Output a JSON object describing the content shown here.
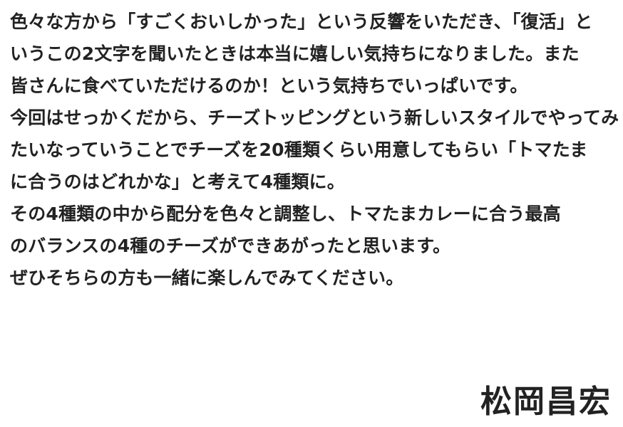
{
  "message": {
    "lines": [
      "色々な方から「すごくおいしかった」という反響をいただき、「復活」と",
      "いうこの2文字を聞いたときは本当に嬉しい気持ちになりました。また",
      "皆さんに食べていただけるのか！という気持ちでいっぱいです。",
      "今回はせっかくだから、チーズトッピングという新しいスタイルでやってみ",
      "たいなっていうことでチーズを20種類くらい用意してもらい「トマたま",
      "に合うのはどれかな」と考えて4種類に。",
      "その4種類の中から配分を色々と調整し、トマたまカレーに合う最高",
      "のバランスの4種のチーズができあがったと思います。",
      "ぜひそちらの方も一緒に楽しんでみてください。"
    ]
  },
  "signature": {
    "name": "松岡昌宏"
  },
  "colors": {
    "text": "#222222",
    "background": "#ffffff"
  }
}
